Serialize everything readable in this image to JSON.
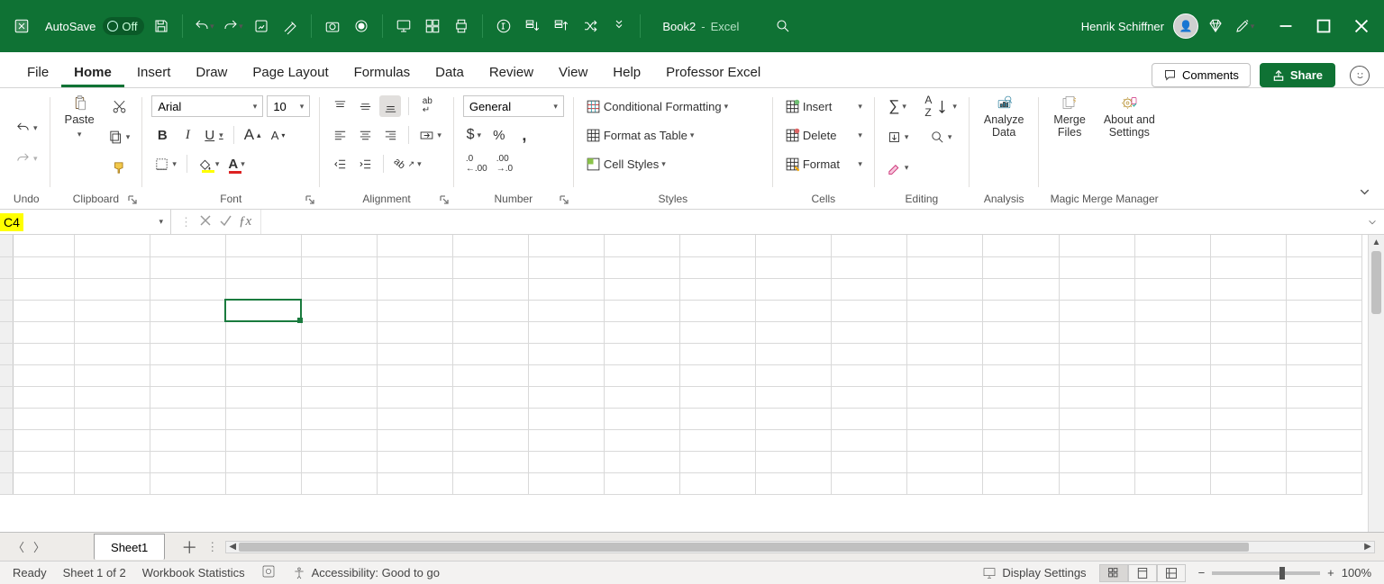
{
  "title": {
    "autosave": "AutoSave",
    "autosave_state": "Off",
    "doc": "Book2",
    "app": "Excel",
    "user": "Henrik Schiffner"
  },
  "menu": [
    "File",
    "Home",
    "Insert",
    "Draw",
    "Page Layout",
    "Formulas",
    "Data",
    "Review",
    "View",
    "Help",
    "Professor Excel"
  ],
  "menu_active": 1,
  "comments": "Comments",
  "share": "Share",
  "ribbon": {
    "undo": "Undo",
    "clipboard": {
      "paste": "Paste",
      "label": "Clipboard"
    },
    "font": {
      "name": "Arial",
      "size": "10",
      "label": "Font"
    },
    "alignment": {
      "label": "Alignment"
    },
    "number": {
      "format": "General",
      "label": "Number"
    },
    "styles": {
      "cond": "Conditional Formatting",
      "table": "Format as Table",
      "cell": "Cell Styles",
      "label": "Styles"
    },
    "cells": {
      "insert": "Insert",
      "delete": "Delete",
      "format": "Format",
      "label": "Cells"
    },
    "editing": {
      "label": "Editing"
    },
    "analysis": {
      "analyze": "Analyze Data",
      "label": "Analysis"
    },
    "magic": {
      "merge": "Merge Files",
      "settings": "About and Settings",
      "label": "Magic Merge Manager"
    }
  },
  "name_box": "C4",
  "sheet": {
    "name": "Sheet1"
  },
  "status": {
    "ready": "Ready",
    "sheets": "Sheet 1 of 2",
    "stats": "Workbook Statistics",
    "acc": "Accessibility: Good to go",
    "display": "Display Settings",
    "zoom": "100%"
  }
}
